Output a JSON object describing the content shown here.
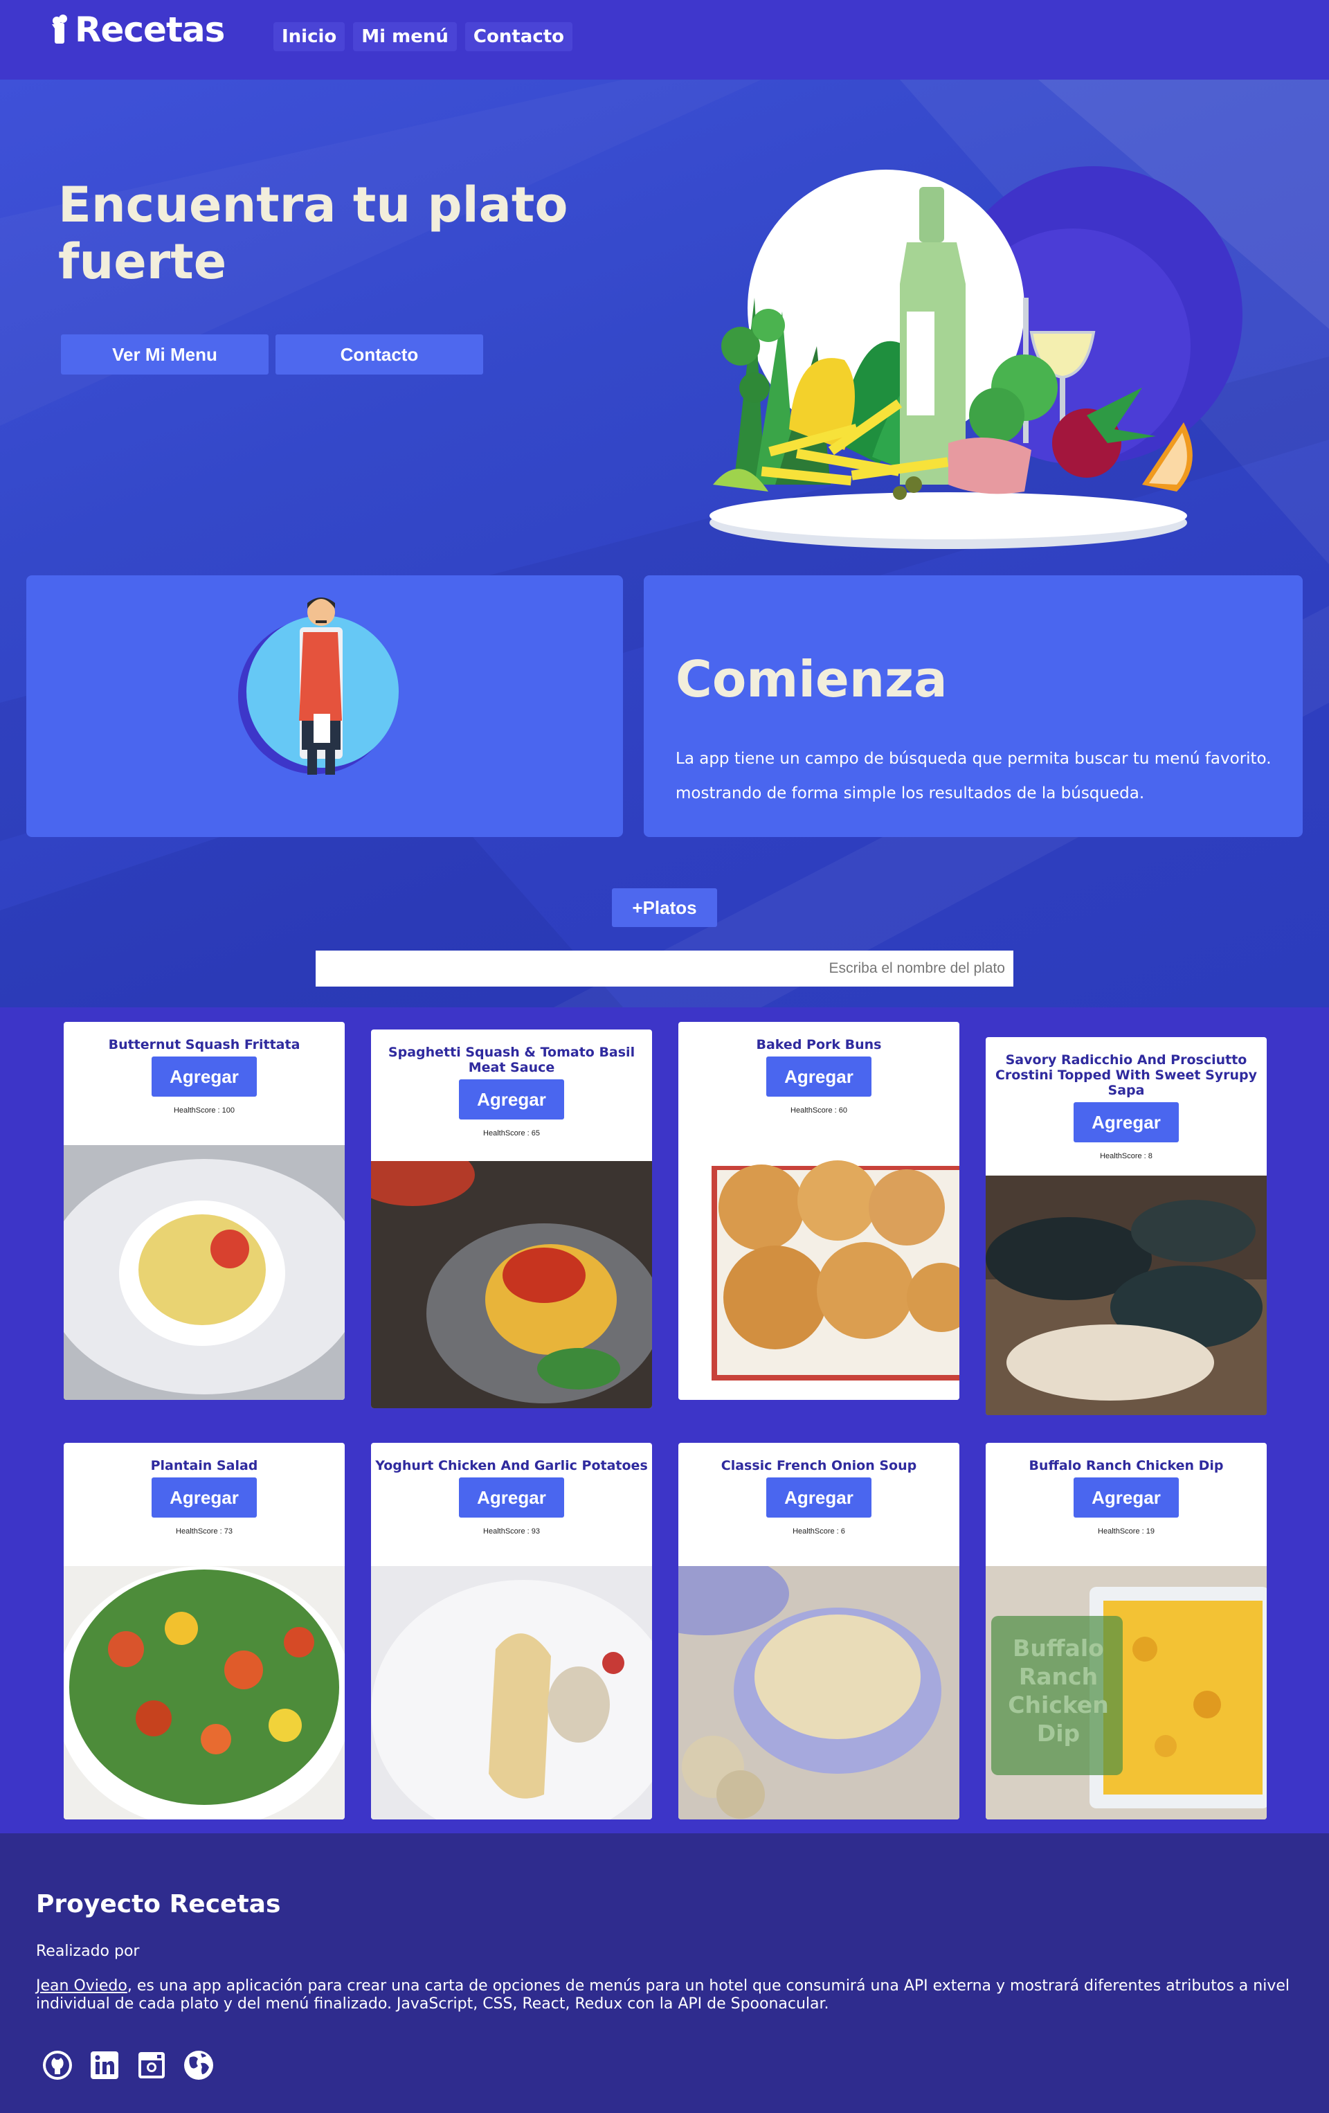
{
  "nav": {
    "logo": "Recetas",
    "links": [
      "Inicio",
      "Mi menú",
      "Contacto"
    ]
  },
  "hero": {
    "title": "Encuentra tu plato fuerte",
    "buttons": [
      "Ver Mi Menu",
      "Contacto"
    ]
  },
  "intro": {
    "title": "Comienza",
    "text": "La app tiene un campo de búsqueda que permita buscar tu menú favorito. mostrando de forma simple los resultados de la búsqueda."
  },
  "search": {
    "add_button": "+Platos",
    "placeholder": "Escriba el nombre del plato"
  },
  "dishes": [
    {
      "title": "Butternut Squash Frittata",
      "button": "Agregar",
      "health": "HealthScore : 100"
    },
    {
      "title": "Spaghetti Squash & Tomato Basil Meat Sauce",
      "button": "Agregar",
      "health": "HealthScore : 65"
    },
    {
      "title": "Baked Pork Buns",
      "button": "Agregar",
      "health": "HealthScore : 60"
    },
    {
      "title": "Savory Radicchio And Prosciutto Crostini Topped With Sweet Syrupy Sapa",
      "button": "Agregar",
      "health": "HealthScore : 8"
    },
    {
      "title": "Plantain Salad",
      "button": "Agregar",
      "health": "HealthScore : 73"
    },
    {
      "title": "Yoghurt Chicken And Garlic Potatoes",
      "button": "Agregar",
      "health": "HealthScore : 93"
    },
    {
      "title": "Classic French Onion Soup",
      "button": "Agregar",
      "health": "HealthScore : 6"
    },
    {
      "title": "Buffalo Ranch Chicken Dip",
      "button": "Agregar",
      "health": "HealthScore : 19",
      "overlay": "Buffalo Ranch Chicken Dip"
    }
  ],
  "footer": {
    "title": "Proyecto Recetas",
    "by": "Realizado por",
    "author": "Jean Oviedo",
    "description": ", es una app aplicación para crear una carta de opciones de menús para un hotel que consumirá una API externa y mostrará diferentes atributos a nivel individual de cada plato y del menú finalizado. JavaScript, CSS, React, Redux con la API de Spoonacular.",
    "socials": [
      "github-icon",
      "linkedin-icon",
      "instagram-icon",
      "globe-icon"
    ]
  },
  "colors": {
    "nav": "#3f37cc",
    "accent": "#4a66ef",
    "footer": "#2f2c8e",
    "title_text": "#f2eedc",
    "card_title": "#2f2a9e"
  }
}
